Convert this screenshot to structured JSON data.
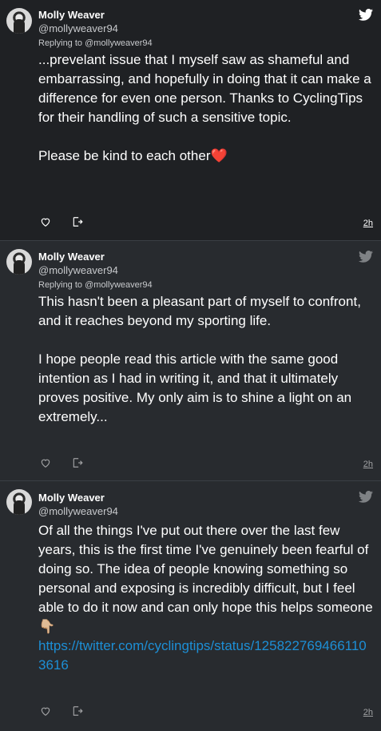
{
  "colors": {
    "bg_first": "#1f2124",
    "bg_other": "#282b2f",
    "text": "#ffffff",
    "muted": "#c7c9cc",
    "link": "#1d8fd6"
  },
  "tweets": [
    {
      "name": "Molly Weaver",
      "handle": "@mollyweaver94",
      "reply_prefix": "Replying to",
      "reply_to": "@mollyweaver94",
      "text": "...prevelant issue that I myself saw as shameful and embarrassing, and hopefully in doing that it can make a difference for even one person. Thanks to CyclingTips for their handling of such a sensitive topic.",
      "text2": "Please be kind to each other",
      "emoji": "❤️",
      "time": "2h",
      "icons": [
        "twitter-bird-icon",
        "heart-icon",
        "share-icon"
      ]
    },
    {
      "name": "Molly Weaver",
      "handle": "@mollyweaver94",
      "reply_prefix": "Replying to",
      "reply_to": "@mollyweaver94",
      "text": "This hasn't been a pleasant part of myself to confront, and it reaches beyond my sporting life.",
      "text2": "I hope people read this article with the same good intention as I had in writing it, and that it ultimately proves positive. My only aim is to shine a light on an extremely...",
      "time": "2h",
      "icons": [
        "twitter-bird-icon",
        "heart-icon",
        "share-icon"
      ]
    },
    {
      "name": "Molly Weaver",
      "handle": "@mollyweaver94",
      "text": "Of all the things I've put out there over the last few years, this is the first time I've genuinely been fearful of doing so. The idea of people knowing something so personal and exposing is incredibly difficult, but I feel able to do it now and can only hope this helps someone",
      "emoji": "👇🏼",
      "link": "https://twitter.com/cyclingtips/status/1258227694661103616",
      "time": "2h",
      "icons": [
        "twitter-bird-icon",
        "heart-icon",
        "share-icon"
      ]
    }
  ]
}
